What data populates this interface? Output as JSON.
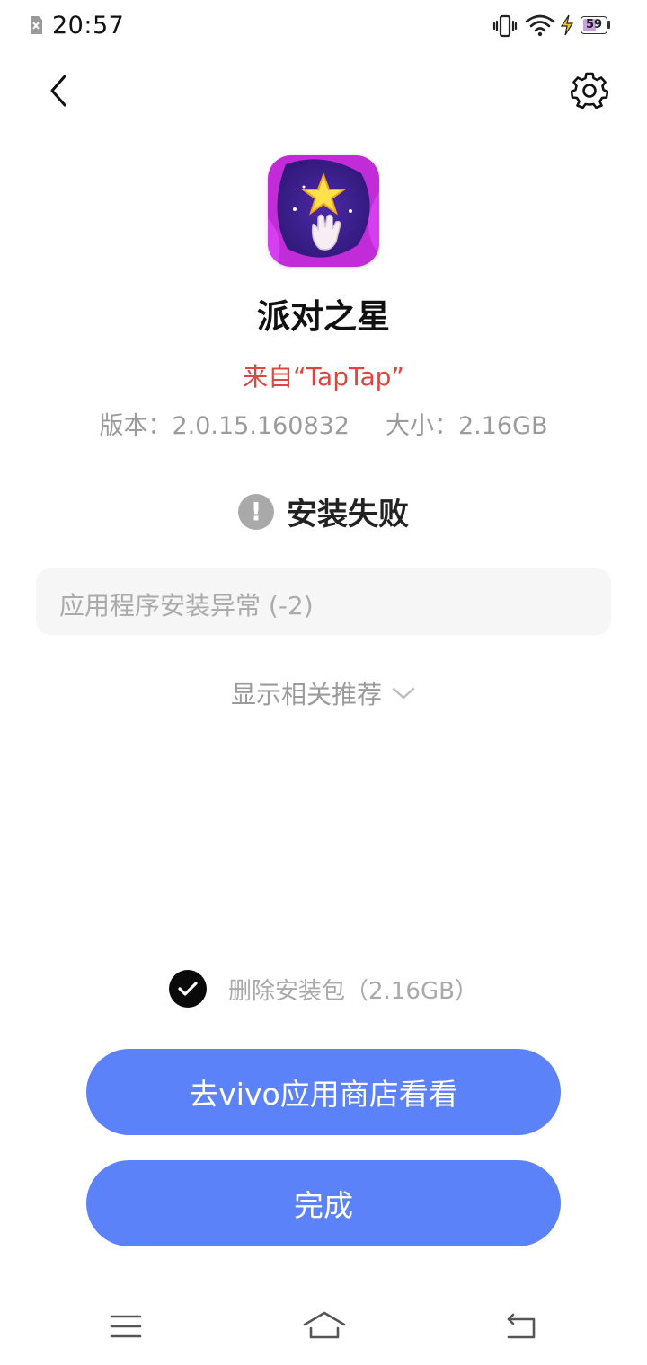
{
  "status_bar": {
    "time": "20:57",
    "battery_level": "59",
    "battery_fraction": 0.59,
    "icons": [
      "sim-icon",
      "vibrate-icon",
      "wifi-icon",
      "charging-icon",
      "battery-icon"
    ]
  },
  "header": {
    "back_icon": "chevron-left-icon",
    "settings_icon": "gear-icon"
  },
  "app": {
    "name": "派对之星",
    "source": "来自“TapTap”",
    "version": "版本：2.0.15.160832",
    "size": "大小：2.16GB",
    "icon": "party-star-app-icon"
  },
  "install_status": {
    "icon": "exclamation-icon",
    "text": "安装失败",
    "error_message": "应用程序安装异常 (-2)"
  },
  "recommend": {
    "label": "显示相关推荐",
    "icon": "chevron-down-icon"
  },
  "delete_package": {
    "label": "删除安装包（2.16GB）",
    "checked": true
  },
  "buttons": {
    "store": "去vivo应用商店看看",
    "done": "完成"
  },
  "nav_bar": {
    "icons": [
      "menu-icon",
      "home-icon",
      "back-icon"
    ]
  },
  "colors": {
    "accent": "#5b82f9",
    "source_red": "#e0443e",
    "muted_gray": "#9b9b9b"
  }
}
